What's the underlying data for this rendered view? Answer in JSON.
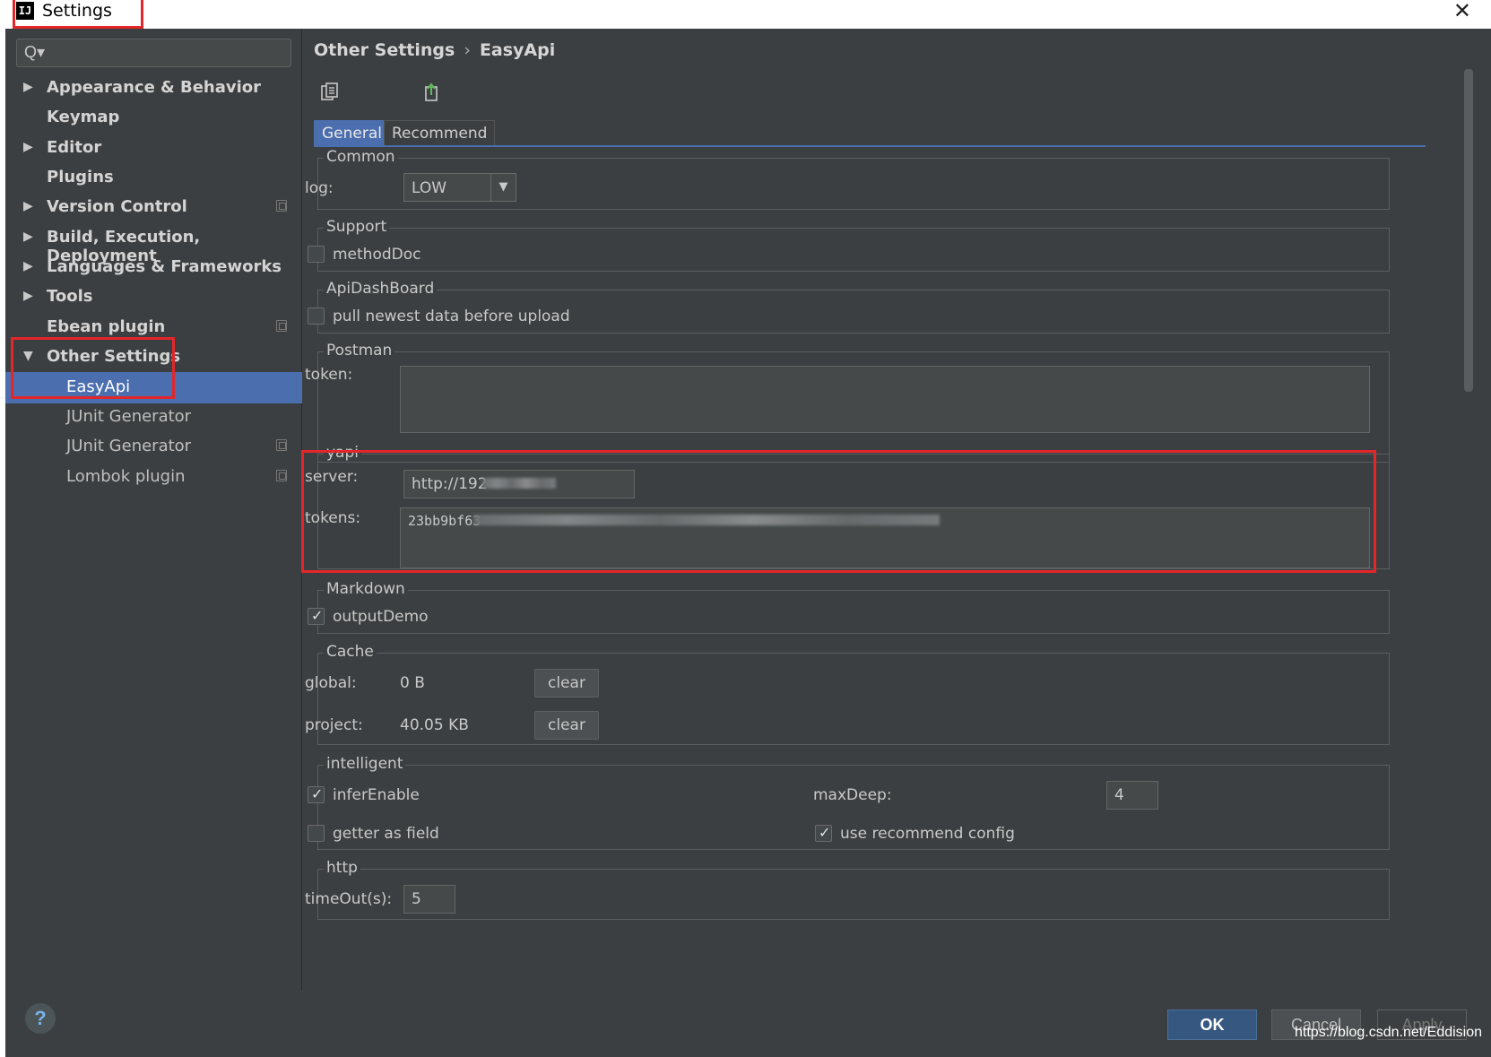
{
  "window": {
    "title": "Settings",
    "app_icon": "IJ",
    "close_glyph": "✕"
  },
  "sidebar": {
    "search_icon": "Q▾",
    "items": [
      {
        "label": "Appearance & Behavior",
        "expandable": true
      },
      {
        "label": "Keymap",
        "expandable": false
      },
      {
        "label": "Editor",
        "expandable": true
      },
      {
        "label": "Plugins",
        "expandable": false
      },
      {
        "label": "Version Control",
        "expandable": true
      },
      {
        "label": "Build, Execution, Deployment",
        "expandable": true
      },
      {
        "label": "Languages & Frameworks",
        "expandable": true
      },
      {
        "label": "Tools",
        "expandable": true
      },
      {
        "label": "Ebean plugin",
        "expandable": false
      },
      {
        "label": "Other Settings",
        "expandable": true,
        "expanded": true
      },
      {
        "label": "EasyApi",
        "child": true,
        "selected": true
      },
      {
        "label": "JUnit Generator",
        "child": true
      },
      {
        "label": "JUnit Generator",
        "child": true
      },
      {
        "label": "Lombok plugin",
        "child": true
      }
    ]
  },
  "breadcrumb": {
    "parent": "Other Settings",
    "separator": "›",
    "current": "EasyApi"
  },
  "tabs": [
    "General",
    "Recommend"
  ],
  "common": {
    "legend": "Common",
    "log_label": "log:",
    "log_value": "LOW"
  },
  "support": {
    "legend": "Support",
    "method_doc": "methodDoc"
  },
  "api_dashboard": {
    "legend": "ApiDashBoard",
    "pull_newest": "pull newest data before upload"
  },
  "postman": {
    "legend": "Postman",
    "token_label": "token:"
  },
  "yapi": {
    "legend": "yapi",
    "server_label": "server:",
    "server_value": "http://192",
    "tokens_label": "tokens:",
    "tokens_value": "23bb9bf63"
  },
  "markdown": {
    "legend": "Markdown",
    "output_demo": "outputDemo"
  },
  "cache": {
    "legend": "Cache",
    "global_label": "global:",
    "global_value": "0 B",
    "project_label": "project:",
    "project_value": "40.05 KB",
    "clear_label": "clear"
  },
  "intelligent": {
    "legend": "intelligent",
    "infer_enable": "inferEnable",
    "max_deep_label": "maxDeep:",
    "max_deep_value": "4",
    "getter_as_field": "getter as field",
    "use_recommend": "use recommend config"
  },
  "http": {
    "legend": "http",
    "timeout_label": "timeOut(s):",
    "timeout_value": "5"
  },
  "footer": {
    "help": "?",
    "ok": "OK",
    "cancel": "Cancel",
    "apply": "Apply",
    "watermark": "https://blog.csdn.net/Eddision"
  },
  "colors": {
    "background": "#3c3f41",
    "selection": "#4b6eaf",
    "highlight_box": "#e3262a"
  }
}
